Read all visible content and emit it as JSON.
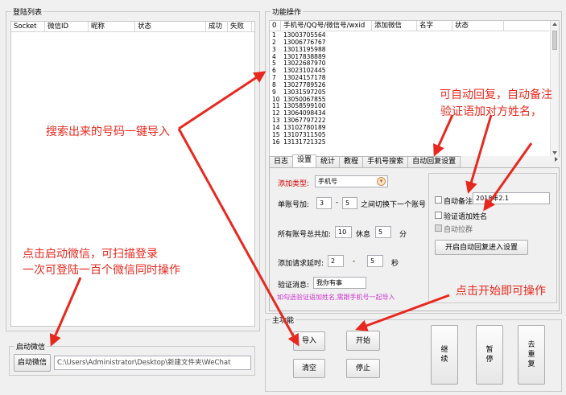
{
  "login_list": {
    "title": "登陆列表",
    "columns": [
      "Socket",
      "微信ID",
      "昵称",
      "状态",
      "成功",
      "失败"
    ]
  },
  "start_wechat": {
    "title": "启动微信",
    "button": "启动微信",
    "path": "C:\\Users\\Administrator\\Desktop\\新建文件夹\\WeChat"
  },
  "func_ops": {
    "title": "功能操作",
    "columns": [
      "0",
      "手机号/QQ号/微信号/wxid",
      "添加微信",
      "名字",
      "状态"
    ],
    "rows": [
      {
        "n": "1",
        "phone": "13003705564"
      },
      {
        "n": "2",
        "phone": "13006776767"
      },
      {
        "n": "3",
        "phone": "13013195988"
      },
      {
        "n": "4",
        "phone": "13017838889"
      },
      {
        "n": "5",
        "phone": "13022687970"
      },
      {
        "n": "6",
        "phone": "13023102445"
      },
      {
        "n": "7",
        "phone": "13024157178"
      },
      {
        "n": "8",
        "phone": "13027789526"
      },
      {
        "n": "9",
        "phone": "13031597205"
      },
      {
        "n": "10",
        "phone": "13050067855"
      },
      {
        "n": "11",
        "phone": "13058599100"
      },
      {
        "n": "12",
        "phone": "13064098434"
      },
      {
        "n": "13",
        "phone": "13067797222"
      },
      {
        "n": "14",
        "phone": "13102780189"
      },
      {
        "n": "15",
        "phone": "13107311505"
      },
      {
        "n": "16",
        "phone": "13131721325"
      }
    ]
  },
  "tabs": [
    "日志",
    "设置",
    "统计",
    "教程",
    "手机号搜索",
    "自动回复设置"
  ],
  "settings": {
    "add_type_label": "添加类型:",
    "add_type_value": "手机号",
    "single_label": "单账号加:",
    "single_from": "3",
    "dash": "-",
    "single_to": "5",
    "single_suffix": "之间切换下一个账号",
    "total_label": "所有账号总共加:",
    "total_value": "10",
    "rest_label": "休息",
    "rest_value": "5",
    "minute_unit": "分",
    "delay_label": "添加请求延时:",
    "delay_from": "2",
    "delay_to": "5",
    "second_unit": "秒",
    "verify_label": "验证消息:",
    "verify_value": "我你有事",
    "hint": "如勾选验证语加姓名,需跟手机号一起导入",
    "auto_remark_label": "自动备注",
    "auto_remark_value": "2018年2.1",
    "verify_name_label": "验证语加姓名",
    "auto_pull_label": "自动拉群",
    "auto_reply_button": "开启自动回复进入设置"
  },
  "main_func": {
    "title": "主功能",
    "import": "导入",
    "start": "开始",
    "clear": "清空",
    "stop": "停止",
    "continue": "继\n续",
    "pause": "暂\n停",
    "dedupe": "去\n重\n复"
  },
  "annotations": {
    "import_tip": "搜索出来的号码一键导入",
    "auto_reply_tip_1": "可自动回复，自动备注",
    "auto_reply_tip_2": "验证语加对方姓名，",
    "login_tip_1": "点击启动微信，可扫描登录",
    "login_tip_2": "一次可登陆一百个微信同时操作",
    "start_tip": "点击开始即可操作"
  },
  "colors": {
    "annotation": "#e8281e",
    "hint": "#cc33cc",
    "required": "#d00000"
  }
}
